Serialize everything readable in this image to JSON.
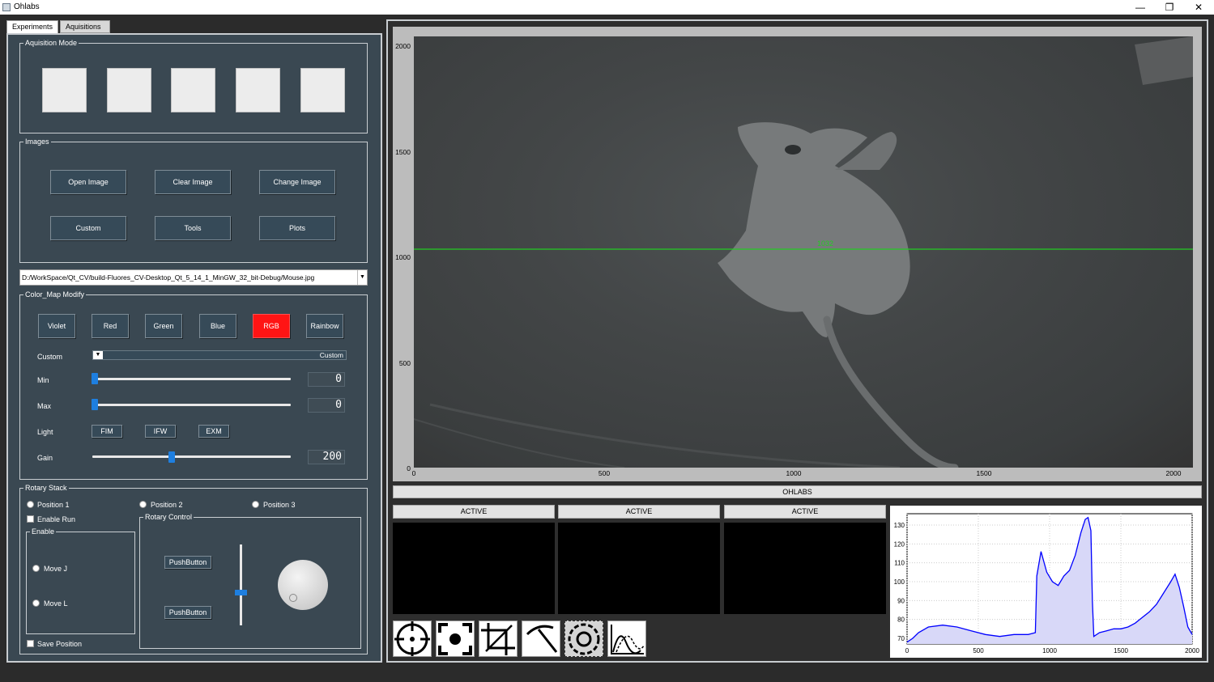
{
  "window": {
    "title": "Ohlabs",
    "minimize": "—",
    "restore": "❐",
    "close": "✕"
  },
  "tabs": [
    {
      "label": "Experiments",
      "active": true
    },
    {
      "label": "Aquisitions",
      "active": false
    }
  ],
  "acquisition_mode": {
    "label": "Aquisition Mode"
  },
  "images": {
    "label": "Images",
    "buttons": [
      "Open Image",
      "Clear Image",
      "Change Image",
      "Custom",
      "Tools",
      "Plots"
    ]
  },
  "file_path": "D:/WorkSpace/Qt_CV/build-Fluores_CV-Desktop_Qt_5_14_1_MinGW_32_bit-Debug/Mouse.jpg",
  "color_map": {
    "label": "Color_Map Modify",
    "buttons": [
      "Violet",
      "Red",
      "Green",
      "Blue",
      "RGB",
      "Rainbow"
    ],
    "active_button": "RGB",
    "active_color": "#ff1414",
    "custom_label": "Custom",
    "custom_value": "Custom",
    "min_label": "Min",
    "min_value": "0",
    "max_label": "Max",
    "max_value": "0",
    "light_label": "Light",
    "light_buttons": [
      "FIM",
      "IFW",
      "EXM"
    ],
    "gain_label": "Gain",
    "gain_value": "200"
  },
  "rotary_stack": {
    "label": "Rotary Stack",
    "positions": [
      "Position 1",
      "Position 2",
      "Position 3"
    ],
    "enable_run": "Enable Run",
    "enable_group": "Enable",
    "moves": [
      "Move J",
      "Move L"
    ],
    "rotary_control": "Rotary Control",
    "pushbuttons": [
      "PushButton",
      "PushButton"
    ],
    "save_position": "Save Position"
  },
  "image_plot": {
    "y_ticks": [
      "2000",
      "1500",
      "1000",
      "500",
      "0"
    ],
    "x_ticks": [
      "0",
      "500",
      "1000",
      "1500",
      "2000"
    ],
    "line_label": "1032",
    "line_value": 1032,
    "line_color": "#22cc22"
  },
  "banner": "OHLABS",
  "active_labels": [
    "ACTIVE",
    "ACTIVE",
    "ACTIVE"
  ],
  "tools": [
    "crosshair-icon",
    "focus-icon",
    "crop-icon",
    "pickaxe-icon",
    "circle-select-icon",
    "curve-plot-icon"
  ],
  "chart_data": {
    "type": "area",
    "title": "",
    "xlabel": "",
    "ylabel": "",
    "xlim": [
      0,
      2000
    ],
    "ylim": [
      67,
      136
    ],
    "x_ticks": [
      0,
      500,
      1000,
      1500,
      2000
    ],
    "y_ticks": [
      70,
      80,
      90,
      100,
      110,
      120,
      130
    ],
    "grid": true,
    "color": "#0000ff",
    "fill": "#d8d8f8",
    "series": [
      {
        "x": [
          0,
          40,
          80,
          150,
          250,
          350,
          450,
          550,
          650,
          750,
          850,
          900,
          910,
          940,
          980,
          1020,
          1060,
          1100,
          1140,
          1180,
          1220,
          1250,
          1270,
          1290,
          1300,
          1310,
          1350,
          1400,
          1450,
          1500,
          1550,
          1600,
          1650,
          1700,
          1750,
          1800,
          1850,
          1880,
          1910,
          1940,
          1970,
          2000
        ],
        "y": [
          68,
          70,
          73,
          76,
          77,
          76,
          74,
          72,
          71,
          72,
          72,
          73,
          103,
          116,
          105,
          100,
          98,
          103,
          106,
          114,
          126,
          133,
          134,
          127,
          90,
          71,
          73,
          74,
          75,
          75,
          76,
          78,
          81,
          84,
          88,
          94,
          100,
          104,
          97,
          87,
          76,
          72
        ]
      }
    ]
  }
}
